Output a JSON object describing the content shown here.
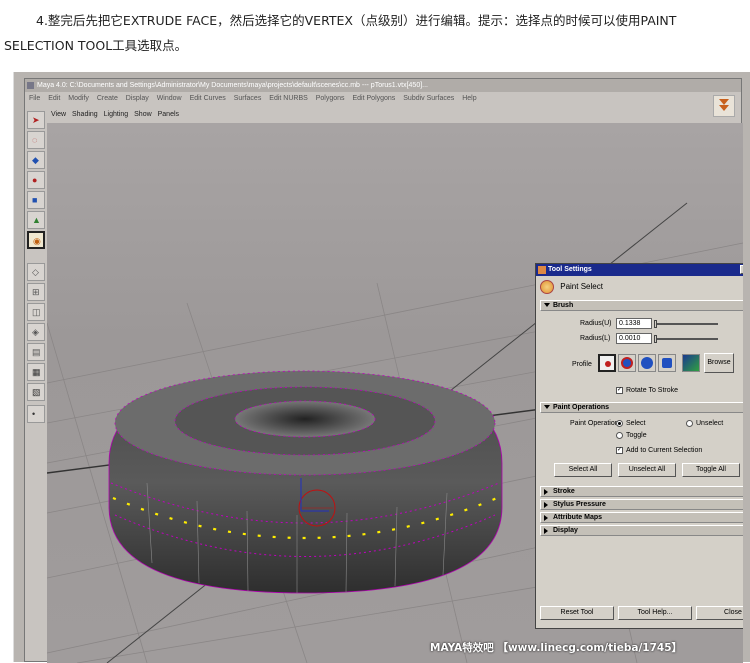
{
  "article": {
    "line1": "4.整完后先把它EXTRUDE FACE，然后选择它的VERTEX（点级别）进行编辑。提示：选择点的时候可以使用PAINT",
    "line2": "SELECTION TOOL工具选取点。"
  },
  "maya": {
    "title": "Maya 4.0: C:\\Documents and Settings\\Administrator\\My Documents\\maya\\projects\\default\\scenes\\cc.mb  ---  pTorus1.vtx[450]...",
    "menus": [
      "File",
      "Edit",
      "Modify",
      "Create",
      "Display",
      "Window",
      "Edit Curves",
      "Surfaces",
      "Edit NURBS",
      "Polygons",
      "Edit Polygons",
      "Subdiv Surfaces",
      "Help"
    ],
    "viewport_menus": [
      "View",
      "Shading",
      "Lighting",
      "Show",
      "Panels"
    ]
  },
  "tool_settings": {
    "title": "Tool Settings",
    "tool_name": "Paint Select",
    "brush": {
      "header": "Brush",
      "radius_u_label": "Radius(U)",
      "radius_u": "0.1338",
      "radius_l_label": "Radius(L)",
      "radius_l": "0.0010",
      "profile_label": "Profile",
      "browse_label": "Browse",
      "rotate_to_stroke": "Rotate To Stroke"
    },
    "paint_operations": {
      "header": "Paint Operations",
      "paint_operation_label": "Paint Operation",
      "select": "Select",
      "unselect": "Unselect",
      "toggle": "Toggle",
      "add_to_current": "Add to Current Selection",
      "select_all": "Select All",
      "unselect_all": "Unselect All",
      "toggle_all": "Toggle All"
    },
    "collapsed_sections": [
      "Stroke",
      "Stylus Pressure",
      "Attribute Maps",
      "Display"
    ],
    "reset_tool": "Reset Tool",
    "tool_help": "Tool Help...",
    "close": "Close"
  },
  "watermark": "MAYA特效吧  【www.linecg.com/tieba/1745】",
  "colors": {
    "title_blue": "#1a2a8c",
    "vertex_magenta": "#c000c0",
    "vertex_yellow": "#ffee00"
  }
}
